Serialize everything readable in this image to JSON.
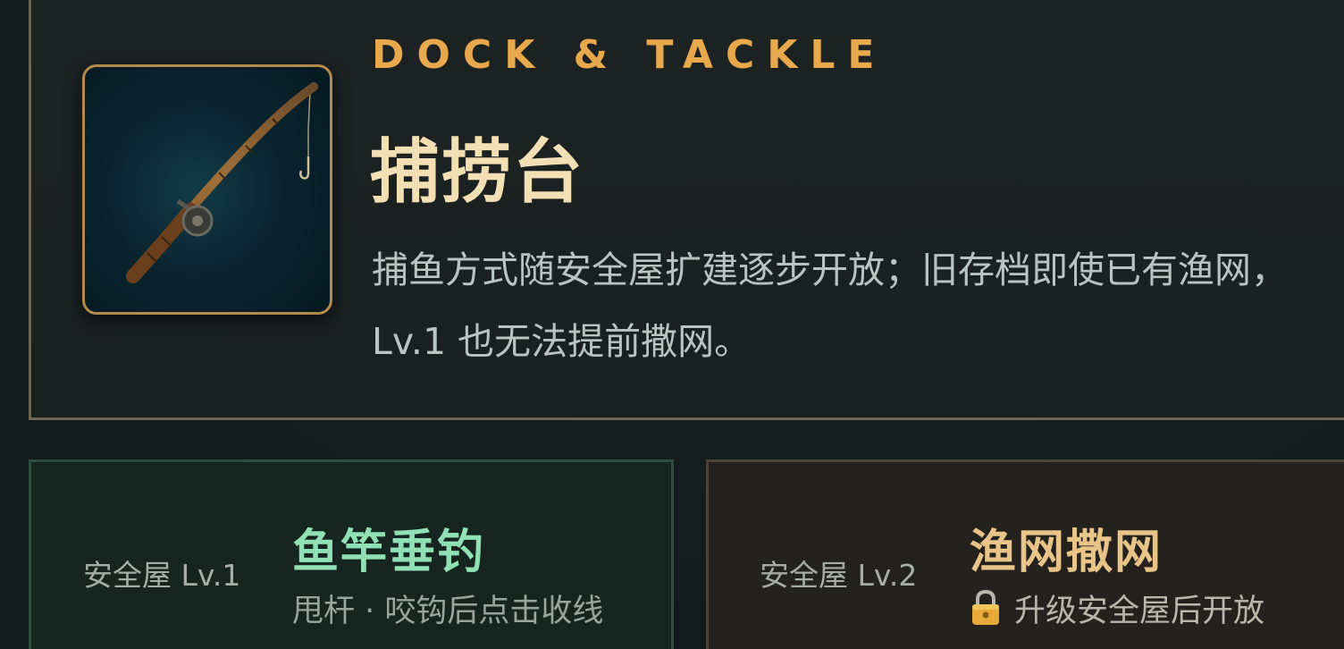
{
  "header": {
    "eyebrow": "DOCK & TACKLE",
    "title": "捕捞台",
    "description": "捕鱼方式随安全屋扩建逐步开放；旧存档即使已有渔网，Lv.1 也无法提前撒网。",
    "item_icon": "fishing-rod-icon"
  },
  "modes": [
    {
      "requirement": "安全屋 Lv.1",
      "name": "鱼竿垂钓",
      "subtitle": "甩杆 · 咬钩后点击收线",
      "state": "unlocked"
    },
    {
      "requirement": "安全屋 Lv.2",
      "name": "渔网撒网",
      "subtitle": "升级安全屋后开放",
      "state": "locked",
      "icon": "lock-icon"
    }
  ],
  "colors": {
    "accent": "#e8a94c",
    "title": "#f2dfb4",
    "unlocked": "#8fe0b4",
    "locked": "#e9c488"
  }
}
